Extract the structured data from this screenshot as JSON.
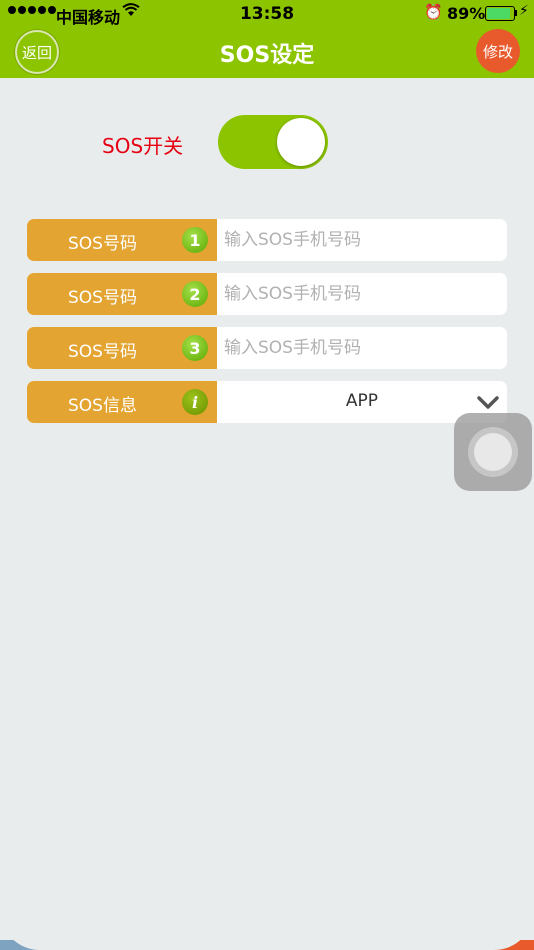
{
  "status_bar": {
    "carrier": "中国移动",
    "time": "13:58",
    "battery_percent": "89%",
    "battery_level": 0.89
  },
  "nav": {
    "title": "SOS设定",
    "back_label": "返回",
    "edit_label": "修改"
  },
  "sos_switch": {
    "label": "SOS开关",
    "on": true
  },
  "rows": [
    {
      "label": "SOS号码",
      "badge": "1",
      "placeholder": "输入SOS手机号码",
      "value": ""
    },
    {
      "label": "SOS号码",
      "badge": "2",
      "placeholder": "输入SOS手机号码",
      "value": ""
    },
    {
      "label": "SOS号码",
      "badge": "3",
      "placeholder": "输入SOS手机号码",
      "value": ""
    }
  ],
  "info_row": {
    "label": "SOS信息",
    "badge": "i",
    "selected": "APP"
  },
  "colors": {
    "brand_green": "#8cc400",
    "row_label_orange": "#e3a431",
    "edit_red": "#e85a2c",
    "switch_label_red": "#e60012",
    "stripes": [
      "#7da3c0",
      "#8fd32d",
      "#e3a431",
      "#e85a2c",
      "#7da3c0",
      "#8fd32d",
      "#e3a431",
      "#e85a2c"
    ]
  }
}
